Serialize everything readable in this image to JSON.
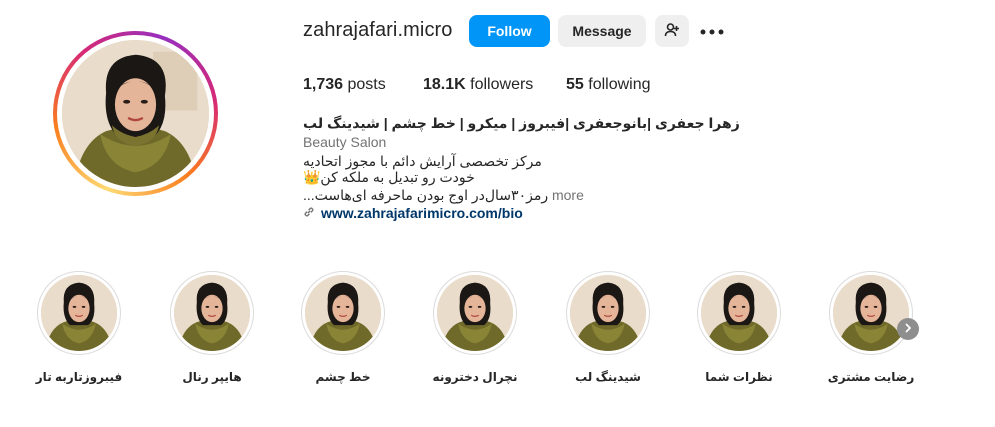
{
  "profile": {
    "username": "zahrajafari.micro",
    "follow_label": "Follow",
    "message_label": "Message",
    "add_user_icon": "person-add-icon",
    "more_icon": "more-dots-icon"
  },
  "stats": {
    "posts_count": "1,736",
    "posts_label": "posts",
    "followers_count": "18.1K",
    "followers_label": "followers",
    "following_count": "55",
    "following_label": "following"
  },
  "bio": {
    "name": "زهرا جعفری |بانوجعفری |فیبروز | میکرو | خط چشم | شیدینگ لب",
    "category": "Beauty Salon",
    "line1": "مرکز تخصصی آرایش دائم با مجوز اتحادیه",
    "line2": "خودت رو تبدیل به ملکه کن👑",
    "line3": "رمز۳۰سال‌در اوج بودن ماحرفه ای‌هاست...",
    "more_label": "more",
    "link_icon": "link-icon",
    "link": "www.zahrajafarimicro.com/bio"
  },
  "highlights": [
    {
      "label": "فیبروزتاربه تار"
    },
    {
      "label": "هایپر رنال"
    },
    {
      "label": "خط چشم"
    },
    {
      "label": "نچرال دخترونه"
    },
    {
      "label": "شیدینگ لب"
    },
    {
      "label": "نظرات شما"
    },
    {
      "label": "رضایت مشتری"
    }
  ],
  "highlights_next_icon": "chevron-right-icon",
  "colors": {
    "follow_button": "#0095f6",
    "secondary_button": "#efefef",
    "link": "#00376b",
    "muted_text": "#737373"
  }
}
